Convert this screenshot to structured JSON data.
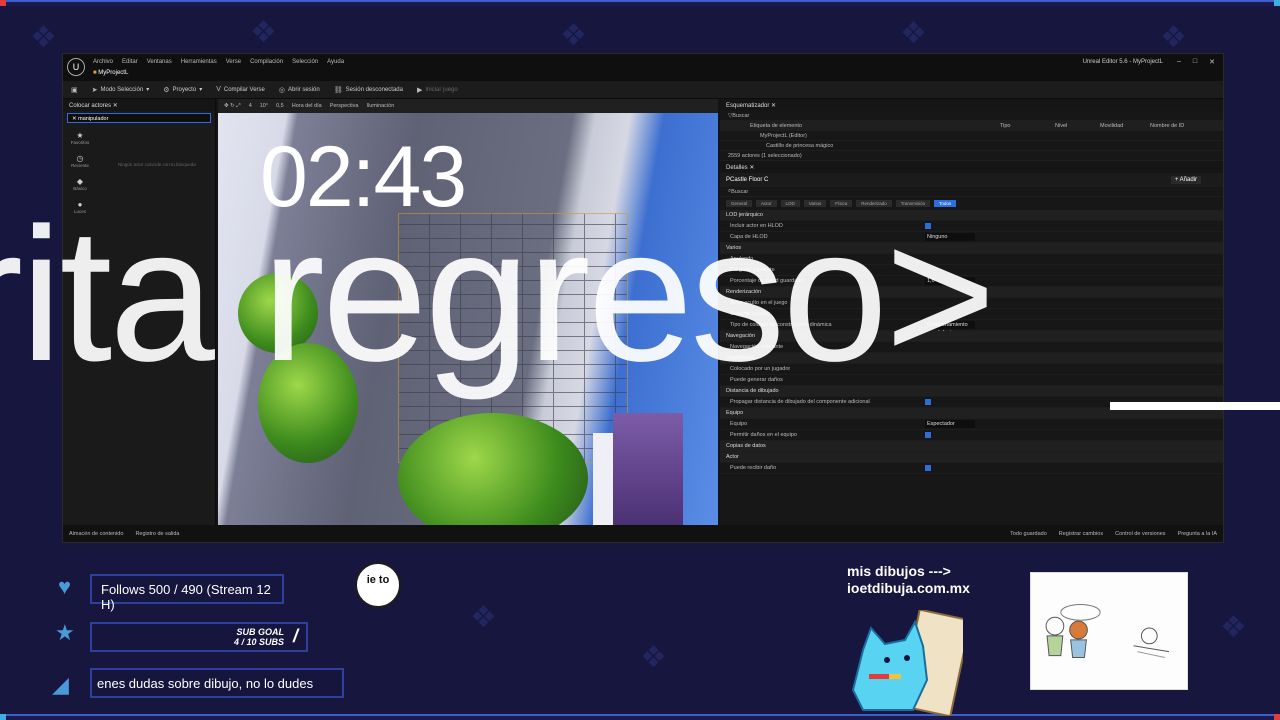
{
  "overlay": {
    "timer": "02:43",
    "marquee": "rita regreso>",
    "follows": "Follows 500 / 490 (Stream 12 H)",
    "sub_goal_line1": "SUB GOAL",
    "sub_goal_line2": "4 / 10 SUBS",
    "ticker": "enes dudas sobre dibujo, no lo dudes",
    "badge": "ie to",
    "promo_line1": "mis dibujos --->",
    "promo_line2": "ioetdibuja.com.mx",
    "frame_color": "#3e5fc8"
  },
  "editor": {
    "app_title": "Unreal Editor 5.6 - MyProjectL",
    "menu": [
      "Archivo",
      "Editar",
      "Ventanas",
      "Herramientas",
      "Verse",
      "Compilación",
      "Selección",
      "Ayuda"
    ],
    "project_tab": "MyProjectL",
    "toolbar": {
      "mode": "Modo Selección",
      "project": "Proyecto",
      "compile": "Compilar Verse",
      "open_session": "Abrir sesión",
      "session_status": "Sesión desconectada",
      "start_game": "Iniciar juego"
    },
    "place_actors": {
      "title": "Colocar actores",
      "search_value": "manipulador",
      "categories": [
        "Favoritos",
        "Reciente",
        "Básico",
        "Luces"
      ],
      "empty_text": "Ningún actor coincide con tu búsqueda"
    },
    "viewport": {
      "perspective": "Perspectiva",
      "lighting": "Iluminación",
      "time_of_day": "Hora del día",
      "scale": "0,5",
      "fov": "10°",
      "speed": "4"
    },
    "outliner": {
      "title": "Esquematizador",
      "search_placeholder": "Buscar",
      "columns": [
        "Etiqueta de elemento",
        "Tipo",
        "Nivel",
        "Movilidad",
        "Nombre de ID"
      ],
      "rows": [
        "MyProjectL (Editor)",
        "Castillo de princesa mágico"
      ],
      "count": "2559 actores (1 seleccionado)"
    },
    "details": {
      "tab": "Detalles",
      "object": "PCastle Floor C",
      "add_label": "+ Añadir",
      "search_placeholder": "Buscar",
      "filters": [
        "General",
        "Actor",
        "LOD",
        "Varios",
        "Física",
        "Renderizado",
        "Transmisión",
        "Todos"
      ],
      "props": [
        {
          "label": "LOD jerárquico",
          "cat": true
        },
        {
          "label": "Incluir actor en HLOD",
          "check": true
        },
        {
          "label": "Capa de HLOD",
          "value": "Ninguno"
        },
        {
          "label": "Varios",
          "cat": true
        },
        {
          "label": "Anulando"
        },
        {
          "label": "Cargado siguiente"
        },
        {
          "label": "Porcentaje de salud guardado",
          "value": "1,0"
        },
        {
          "label": "Renderización",
          "cat": true
        },
        {
          "label": "Actor oculto en el juego"
        },
        {
          "label": "Generar colisión"
        },
        {
          "label": "Tipo de colisión de construcción dinámica",
          "value": "Comportamiento por defecto"
        },
        {
          "label": "Navegación",
          "cat": true
        },
        {
          "label": "Navegación relevante",
          "check": false
        },
        {
          "label": "Jugabilidad",
          "cat": true
        },
        {
          "label": "Colocado por un jugador"
        },
        {
          "label": "Puede generar daños"
        },
        {
          "label": "Distancia de dibujado",
          "cat": true
        },
        {
          "label": "Propagar distancia de dibujado del componente adicional",
          "check": true
        },
        {
          "label": "Equipo",
          "cat": true
        },
        {
          "label": "Equipo",
          "value": "Espectador"
        },
        {
          "label": "Permitir daños en el equipo",
          "check": true
        },
        {
          "label": "Copias de datos",
          "cat": true
        },
        {
          "label": "Actor",
          "cat": true
        },
        {
          "label": "Puede recibir daño",
          "check": true
        }
      ]
    },
    "status": {
      "content": "Almacén de contenido",
      "log": "Registro de salida",
      "saved": "Todo guardado",
      "changes": "Registrar cambios",
      "version": "Control de versiones",
      "ask_ai": "Pregunta a la IA"
    }
  }
}
